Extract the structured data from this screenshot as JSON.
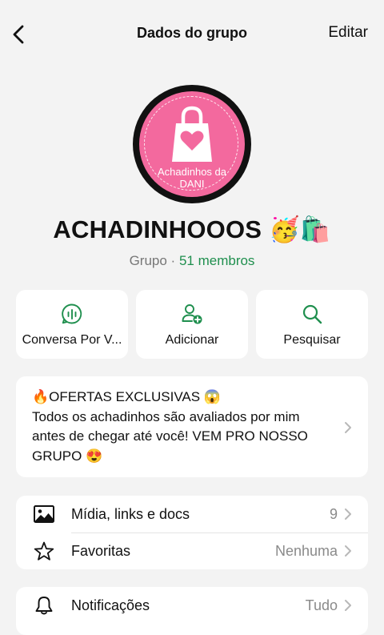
{
  "nav": {
    "title": "Dados do grupo",
    "edit_label": "Editar"
  },
  "avatar": {
    "line1": "Achadinhos da",
    "line2": "DANI"
  },
  "group": {
    "name": "ACHADINHOOOS 🥳🛍️",
    "type_label": "Grupo",
    "separator": "·",
    "members_label": "51 membros"
  },
  "actions": [
    {
      "label": "Conversa Por V...",
      "icon": "voice-chat-icon"
    },
    {
      "label": "Adicionar",
      "icon": "add-person-icon"
    },
    {
      "label": "Pesquisar",
      "icon": "search-icon"
    }
  ],
  "description": {
    "line1": "🔥OFERTAS EXCLUSIVAS 😱",
    "line2": "Todos os achadinhos são avaliados por mim",
    "line3": "antes de chegar até você! VEM PRO NOSSO",
    "line4": "GRUPO 😍"
  },
  "rows": [
    {
      "label": "Mídia, links e docs",
      "value": "9",
      "icon": "image-icon"
    },
    {
      "label": "Favoritas",
      "value": "Nenhuma",
      "icon": "star-icon"
    },
    {
      "label": "Notificações",
      "value": "Tudo",
      "icon": "bell-icon"
    }
  ],
  "colors": {
    "accent": "#1f8f4e",
    "avatar_bg": "#f3699e",
    "background": "#f3f3f3"
  }
}
